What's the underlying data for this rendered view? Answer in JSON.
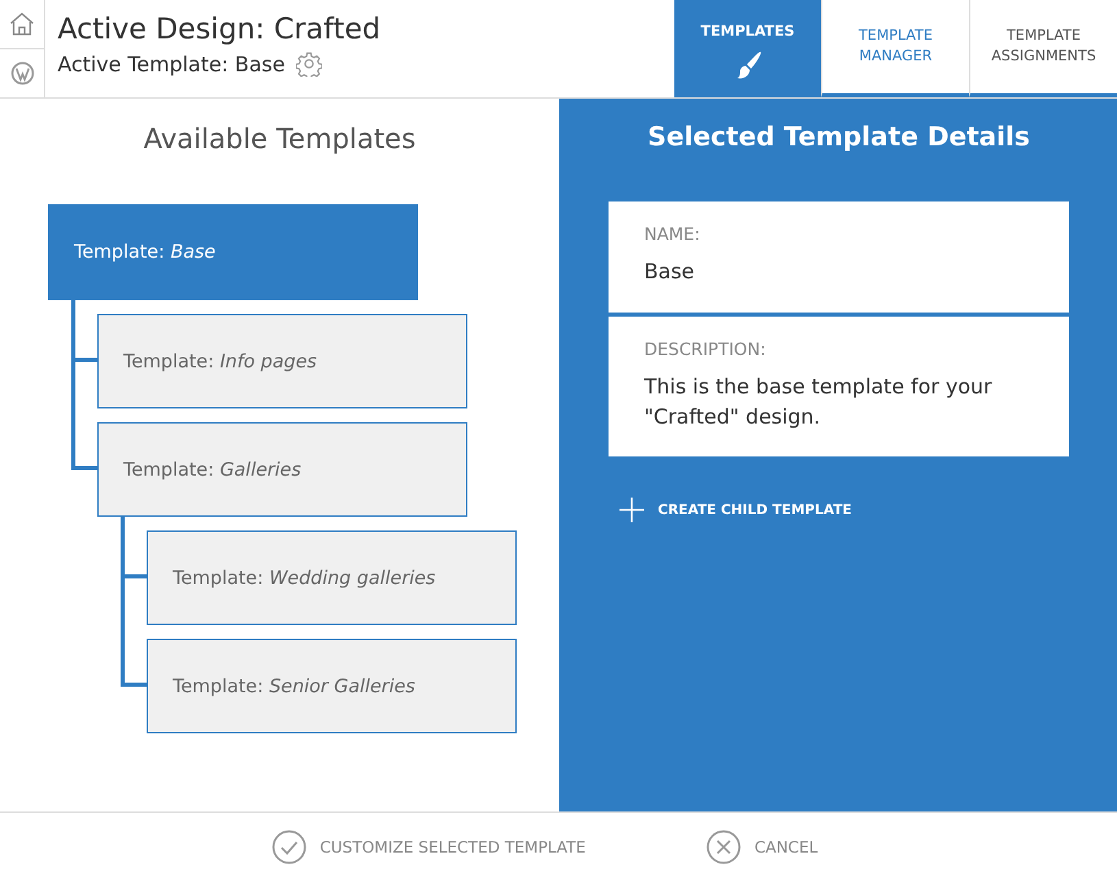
{
  "header": {
    "title": "Active Design: Crafted",
    "subtitle": "Active Template: Base"
  },
  "tabs": [
    {
      "label": "TEMPLATES",
      "selected": true,
      "highlighted": false
    },
    {
      "label": "TEMPLATE MANAGER",
      "selected": false,
      "highlighted": true
    },
    {
      "label": "TEMPLATE ASSIGNMENTS",
      "selected": false,
      "highlighted": false
    }
  ],
  "available": {
    "title": "Available Templates",
    "tree": [
      {
        "label": "Template: *Base*",
        "selected": true,
        "children": [
          {
            "label": "Template: *Info pages*",
            "selected": false
          },
          {
            "label": "Template: *Galleries*",
            "selected": false,
            "children": [
              {
                "label": "Template: *Wedding galleries*",
                "selected": false
              },
              {
                "label": "Template: *Senior Galleries*",
                "selected": false
              }
            ]
          }
        ]
      }
    ]
  },
  "details": {
    "title": "Selected Template Details",
    "fields": [
      {
        "label": "NAME:",
        "value": "Base"
      },
      {
        "label": "DESCRIPTION:",
        "value": "This is the base template for your \"Crafted\" design."
      }
    ],
    "action": "CREATE CHILD TEMPLATE"
  },
  "footer": {
    "buttons": [
      {
        "kind": "confirm",
        "label": "CUSTOMIZE SELECTED TEMPLATE"
      },
      {
        "kind": "cancel",
        "label": "CANCEL"
      }
    ]
  }
}
